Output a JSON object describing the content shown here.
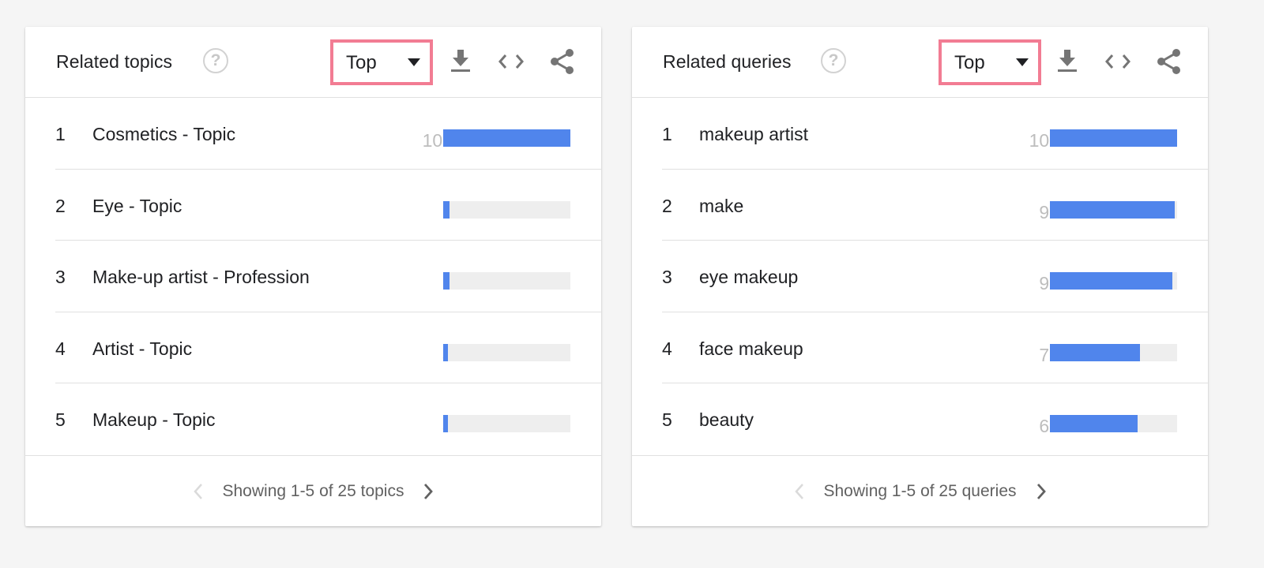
{
  "colors": {
    "bar_fill": "#5085ec",
    "bar_track": "#eeeeee",
    "highlight_border": "#f27c93",
    "icon_gray": "#757575"
  },
  "topics": {
    "title": "Related topics",
    "help_icon": "help-circle-icon",
    "dropdown": {
      "selected": "Top",
      "icon": "caret-down-icon"
    },
    "toolbar": {
      "download_icon": "download-icon",
      "embed_icon": "code-embed-icon",
      "share_icon": "share-icon"
    },
    "rows": [
      {
        "rank": "1",
        "label": "Cosmetics - Topic",
        "value": "100",
        "fraction": 1.0
      },
      {
        "rank": "2",
        "label": "Eye - Topic",
        "value": "5",
        "fraction": 0.05
      },
      {
        "rank": "3",
        "label": "Make-up artist - Profession",
        "value": "5",
        "fraction": 0.05
      },
      {
        "rank": "4",
        "label": "Artist - Topic",
        "value": "4",
        "fraction": 0.04
      },
      {
        "rank": "5",
        "label": "Makeup - Topic",
        "value": "4",
        "fraction": 0.04
      }
    ],
    "footer": {
      "text": "Showing 1-5 of 25 topics",
      "prev_icon": "chevron-left-icon",
      "next_icon": "chevron-right-icon",
      "prev_enabled": false,
      "next_enabled": true
    }
  },
  "queries": {
    "title": "Related queries",
    "help_icon": "help-circle-icon",
    "dropdown": {
      "selected": "Top",
      "icon": "caret-down-icon"
    },
    "toolbar": {
      "download_icon": "download-icon",
      "embed_icon": "code-embed-icon",
      "share_icon": "share-icon"
    },
    "rows": [
      {
        "rank": "1",
        "label": "makeup artist",
        "value": "100",
        "fraction": 1.0
      },
      {
        "rank": "2",
        "label": "make",
        "value": "98",
        "fraction": 0.98
      },
      {
        "rank": "3",
        "label": "eye makeup",
        "value": "96",
        "fraction": 0.96
      },
      {
        "rank": "4",
        "label": "face makeup",
        "value": "71",
        "fraction": 0.71
      },
      {
        "rank": "5",
        "label": "beauty",
        "value": "69",
        "fraction": 0.69
      }
    ],
    "footer": {
      "text": "Showing 1-5 of 25 queries",
      "prev_icon": "chevron-left-icon",
      "next_icon": "chevron-right-icon",
      "prev_enabled": false,
      "next_enabled": true
    }
  }
}
